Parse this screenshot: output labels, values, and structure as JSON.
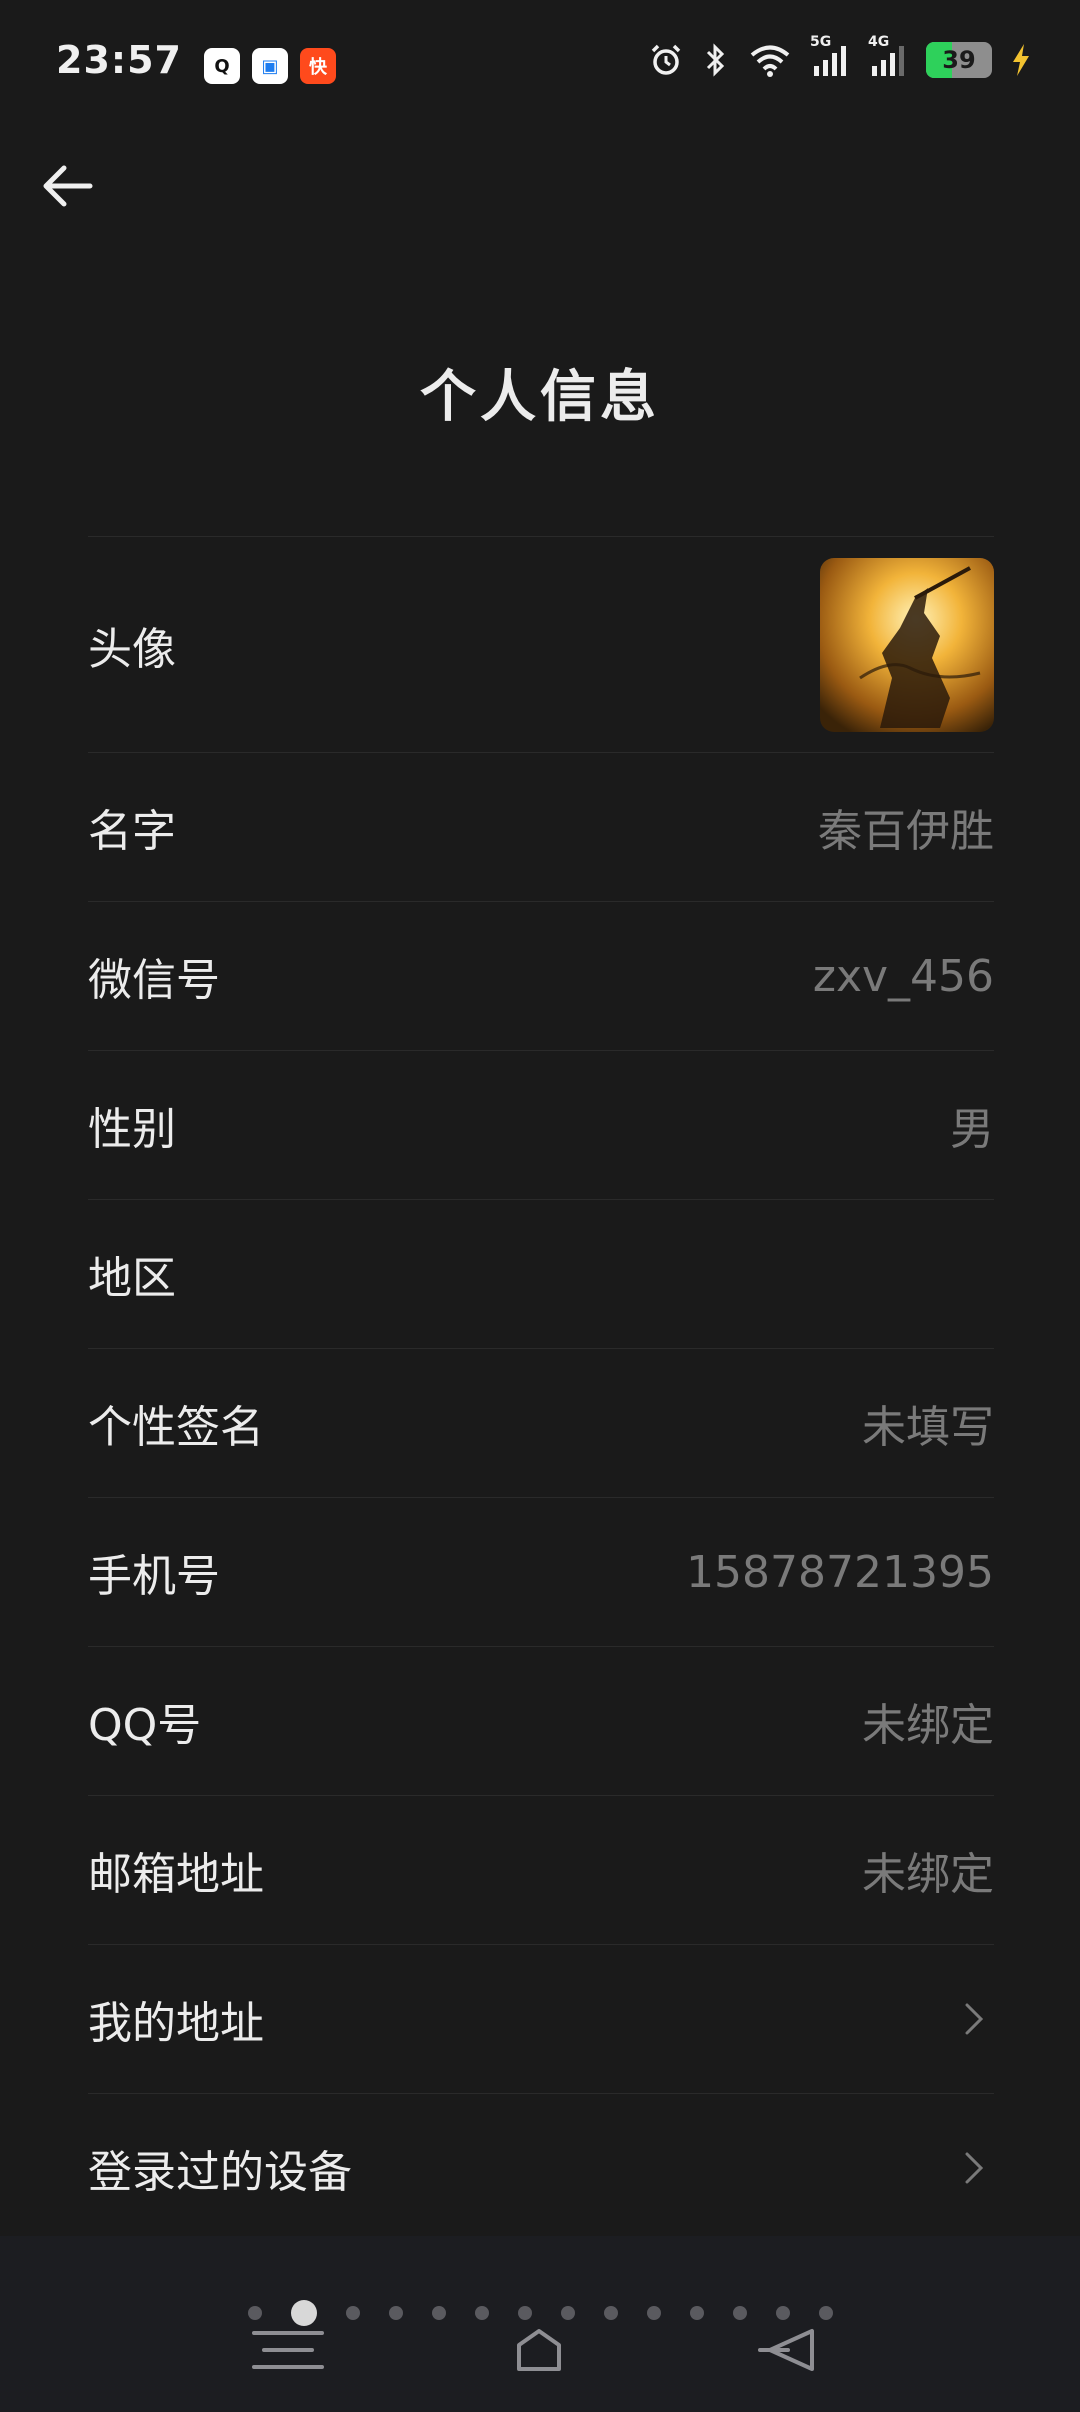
{
  "status_bar": {
    "time": "23:57",
    "apps": [
      "Q",
      "▣",
      "快"
    ],
    "net_5g": "5G",
    "net_4g": "4G",
    "battery": "39",
    "battery_level": 0.39
  },
  "header": {
    "title": "个人信息"
  },
  "profile": {
    "rows": [
      {
        "label": "头像",
        "value": ""
      },
      {
        "label": "名字",
        "value": "秦百伊胜"
      },
      {
        "label": "微信号",
        "value": "zxv_456"
      },
      {
        "label": "性别",
        "value": "男"
      },
      {
        "label": "地区",
        "value": ""
      },
      {
        "label": "个性签名",
        "value": "未填写"
      },
      {
        "label": "手机号",
        "value": "15878721395"
      },
      {
        "label": "QQ号",
        "value": "未绑定"
      },
      {
        "label": "邮箱地址",
        "value": "未绑定"
      },
      {
        "label": "我的地址",
        "value": ""
      },
      {
        "label": "登录过的设备",
        "value": ""
      }
    ]
  },
  "nav": {
    "page_count": 14,
    "active_page": 2
  },
  "colors": {
    "background": "#1a1a1a",
    "text_primary": "#ececec",
    "text_secondary": "#7a7a7a",
    "divider": "#2a2a2a"
  }
}
